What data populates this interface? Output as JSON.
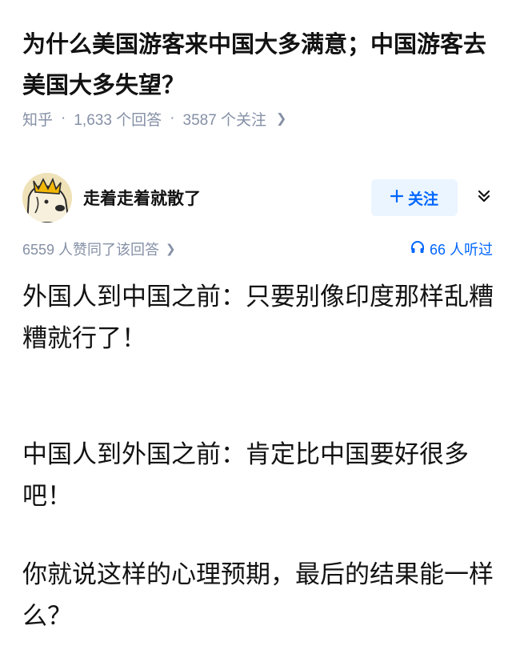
{
  "question": {
    "title": "为什么美国游客来中国大多满意；中国游客去美国大多失望？",
    "source": "知乎",
    "answers_count": "1,633 个回答",
    "followers_count": "3587 个关注"
  },
  "author": {
    "name": "走着走着就散了",
    "follow_label": "关注",
    "follow_icon": "plus-icon",
    "collapse_icon": "double-chevron-down-icon"
  },
  "stats": {
    "upvotes": "6559 人赞同了该回答",
    "listeners": "66 人听过",
    "listen_icon": "headphones-icon"
  },
  "answer": {
    "p1": "外国人到中国之前：只要别像印度那样乱糟糟就行了！",
    "p2": "中国人到外国之前：肯定比中国要好很多吧！",
    "p3": "你就说这样的心理预期，最后的结果能一样么？"
  },
  "colors": {
    "accent": "#0066ff",
    "muted": "#8590a6",
    "follow_bg": "#ebf5ff"
  }
}
